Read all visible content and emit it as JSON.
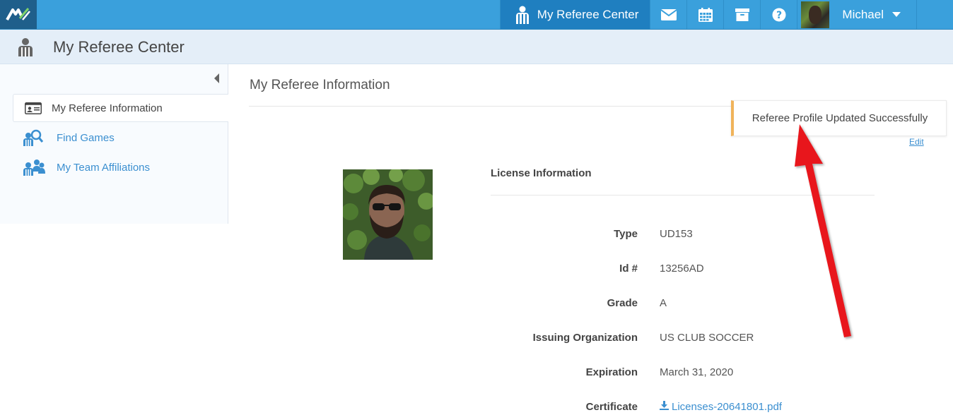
{
  "topbar": {
    "logo_icon": "app-logo-icon",
    "active_item_label": "My Referee Center",
    "icons": [
      "mail-icon",
      "calendar-icon",
      "archive-icon",
      "help-icon"
    ],
    "user_name": "Michael"
  },
  "subheader": {
    "title": "My Referee Center",
    "icon": "referee-icon"
  },
  "sidebar": {
    "items": [
      {
        "label": "My Referee Information",
        "icon": "id-card-icon",
        "active": true
      },
      {
        "label": "Find Games",
        "icon": "search-games-icon",
        "active": false
      },
      {
        "label": "My Team Affiliations",
        "icon": "team-icon",
        "active": false
      }
    ]
  },
  "main": {
    "title": "My Referee Information",
    "toast": "Referee Profile Updated Successfully",
    "edit_label": "Edit",
    "section_title": "License Information",
    "fields": [
      {
        "label": "Type",
        "value": "UD153"
      },
      {
        "label": "Id #",
        "value": "13256AD"
      },
      {
        "label": "Grade",
        "value": "A"
      },
      {
        "label": "Issuing Organization",
        "value": "US CLUB SOCCER"
      },
      {
        "label": "Expiration",
        "value": "March 31, 2020"
      },
      {
        "label": "Certificate",
        "value": "Licenses-20641801.pdf"
      }
    ]
  },
  "colors": {
    "topbar": "#3aa0dc",
    "active_nav": "#1f7fc0",
    "link": "#3b8fd0",
    "toast_accent": "#f0b35a",
    "annotation_arrow": "#e8151b"
  }
}
